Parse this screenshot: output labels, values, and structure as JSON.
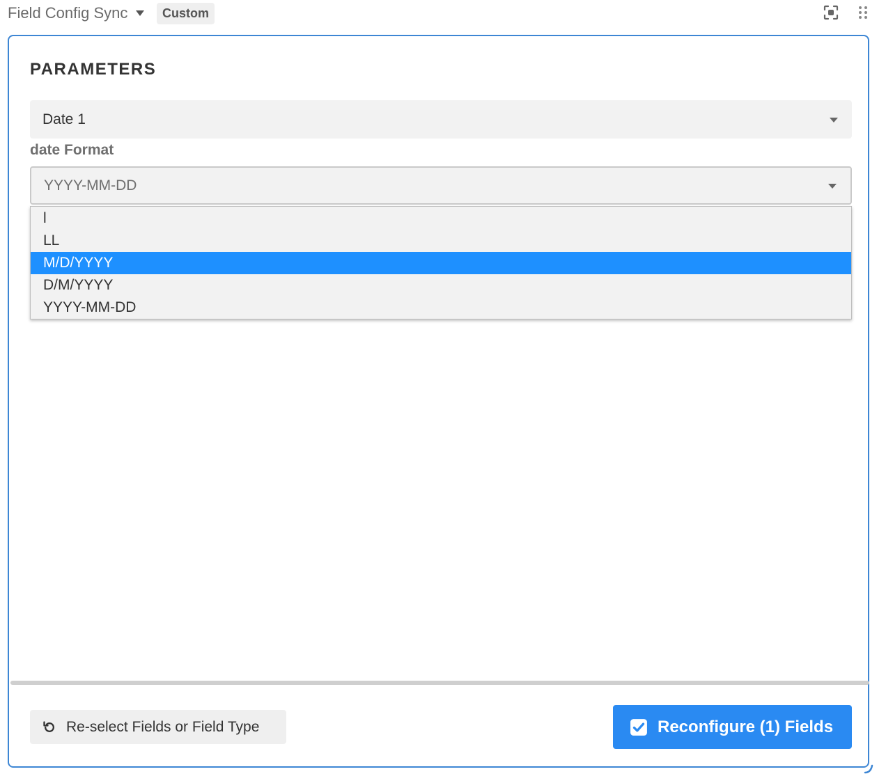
{
  "header": {
    "title": "Field Config Sync",
    "badge": "Custom",
    "icons": [
      "chevron-down-icon",
      "focus-icon",
      "drag-grip-icon"
    ]
  },
  "panel": {
    "section_title": "PARAMETERS",
    "field_select": {
      "value": "Date 1"
    },
    "date_format": {
      "label": "date Format",
      "value": "YYYY-MM-DD",
      "options": [
        "l",
        "LL",
        "M/D/YYYY",
        "D/M/YYYY",
        "YYYY-MM-DD"
      ],
      "highlighted": "M/D/YYYY"
    },
    "buttons": {
      "reselect_label": "Re-select Fields or Field Type",
      "reconfigure_label": "Reconfigure (1) Fields"
    }
  },
  "colors": {
    "accent": "#2a8af2",
    "panel_border": "#3d86d4",
    "highlight": "#1e90ff"
  }
}
